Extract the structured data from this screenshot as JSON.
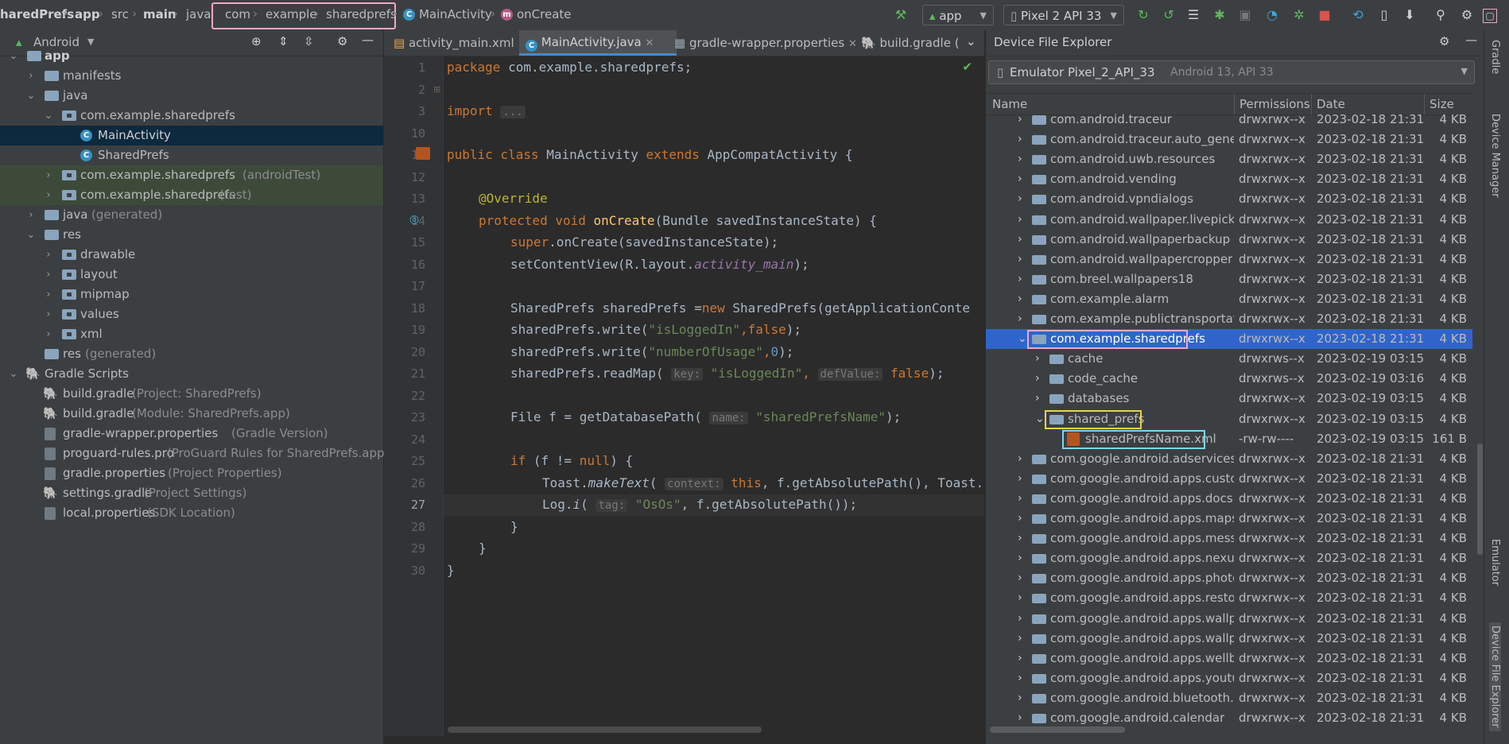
{
  "breadcrumb": [
    "haredPrefs",
    "app",
    "src",
    "main",
    "java",
    "com",
    "example",
    "sharedprefs",
    "MainActivity",
    "onCreate"
  ],
  "toolbar": {
    "run_config": "app",
    "device": "Pixel 2 API 33"
  },
  "project_panel": {
    "view": "Android",
    "tree": [
      {
        "label": "app",
        "extra": ""
      },
      {
        "label": "manifests",
        "extra": ""
      },
      {
        "label": "java",
        "extra": ""
      },
      {
        "label": "com.example.sharedprefs",
        "extra": ""
      },
      {
        "label": "MainActivity",
        "extra": ""
      },
      {
        "label": "SharedPrefs",
        "extra": ""
      },
      {
        "label": "com.example.sharedprefs",
        "extra": "(androidTest)"
      },
      {
        "label": "com.example.sharedprefs",
        "extra": "(test)"
      },
      {
        "label": "java",
        "extra": "(generated)"
      },
      {
        "label": "res",
        "extra": ""
      },
      {
        "label": "drawable",
        "extra": ""
      },
      {
        "label": "layout",
        "extra": ""
      },
      {
        "label": "mipmap",
        "extra": ""
      },
      {
        "label": "values",
        "extra": ""
      },
      {
        "label": "xml",
        "extra": ""
      },
      {
        "label": "res",
        "extra": "(generated)"
      },
      {
        "label": "Gradle Scripts",
        "extra": ""
      },
      {
        "label": "build.gradle",
        "extra": "(Project: SharedPrefs)"
      },
      {
        "label": "build.gradle",
        "extra": "(Module: SharedPrefs.app)"
      },
      {
        "label": "gradle-wrapper.properties",
        "extra": "(Gradle Version)"
      },
      {
        "label": "proguard-rules.pro",
        "extra": "(ProGuard Rules for SharedPrefs.app)"
      },
      {
        "label": "gradle.properties",
        "extra": "(Project Properties)"
      },
      {
        "label": "settings.gradle",
        "extra": "(Project Settings)"
      },
      {
        "label": "local.properties",
        "extra": "(SDK Location)"
      }
    ]
  },
  "editor": {
    "tabs": [
      "activity_main.xml",
      "MainActivity.java",
      "gradle-wrapper.properties",
      "build.gradle ("
    ],
    "line_numbers": [
      "1",
      "2",
      "3",
      "10",
      "11",
      "12",
      "13",
      "14",
      "15",
      "16",
      "17",
      "18",
      "19",
      "20",
      "21",
      "22",
      "23",
      "24",
      "25",
      "26",
      "27",
      "28",
      "29",
      "30"
    ],
    "code": {
      "l1a": "package",
      "l1b": " com.example.sharedprefs;",
      "l3a": "import",
      "l3b": "...",
      "l11a": "public class",
      "l11b": " MainActivity ",
      "l11c": "extends",
      "l11d": " AppCompatActivity {",
      "l13": "@Override",
      "l14a": "protected void",
      "l14b": "onCreate",
      "l14c": "(Bundle savedInstanceState) {",
      "l15a": "super",
      "l15b": ".onCreate(savedInstanceState);",
      "l16a": "setContentView(R.layout.",
      "l16b": "activity_main",
      "l16c": ");",
      "l18a": "SharedPrefs sharedPrefs =",
      "l18b": "new",
      "l18c": " SharedPrefs(getApplicationConte",
      "l19a": "sharedPrefs.write(",
      "l19b": "\"isLoggedIn\"",
      "l19c": ",",
      "l19d": "false",
      "l19e": ");",
      "l20a": "sharedPrefs.write(",
      "l20b": "\"numberOfUsage\"",
      "l20c": ",",
      "l20d": "0",
      "l20e": ");",
      "l21a": "sharedPrefs.readMap(",
      "l21h1": "key:",
      "l21b": "\"isLoggedIn\"",
      "l21c": ",",
      "l21h2": "defValue:",
      "l21d": "false",
      "l21e": ");",
      "l23a": "File f = getDatabasePath(",
      "l23h": "name:",
      "l23b": "\"sharedPrefsName\"",
      "l23c": ");",
      "l25a": "if",
      "l25b": " (f != ",
      "l25c": "null",
      "l25d": ") {",
      "l26a": "Toast.",
      "l26b": "makeText",
      "l26c": "(",
      "l26h": "context:",
      "l26d": "this",
      "l26e": ", f.getAbsolutePath(), Toast.",
      "l27a": "Log.",
      "l27b": "i",
      "l27c": "(",
      "l27h": "tag:",
      "l27d": "\"OsOs\"",
      "l27e": ", f.getAbsolutePath());",
      "l28": "}",
      "l29": "}",
      "l30": "}"
    }
  },
  "device_explorer": {
    "title": "Device File Explorer",
    "device": "Emulator Pixel_2_API_33",
    "device_info": "Android 13, API 33",
    "columns": [
      "Name",
      "Permissions",
      "Date",
      "Size"
    ],
    "rows": [
      {
        "name": "com.android.traceur",
        "perm": "drwxrwx--x",
        "date": "2023-02-18 21:31",
        "size": "4 KB"
      },
      {
        "name": "com.android.traceur.auto_gener",
        "perm": "drwxrwx--x",
        "date": "2023-02-18 21:31",
        "size": "4 KB"
      },
      {
        "name": "com.android.uwb.resources",
        "perm": "drwxrwx--x",
        "date": "2023-02-18 21:31",
        "size": "4 KB"
      },
      {
        "name": "com.android.vending",
        "perm": "drwxrwx--x",
        "date": "2023-02-18 21:31",
        "size": "4 KB"
      },
      {
        "name": "com.android.vpndialogs",
        "perm": "drwxrwx--x",
        "date": "2023-02-18 21:31",
        "size": "4 KB"
      },
      {
        "name": "com.android.wallpaper.livepicke",
        "perm": "drwxrwx--x",
        "date": "2023-02-18 21:31",
        "size": "4 KB"
      },
      {
        "name": "com.android.wallpaperbackup",
        "perm": "drwxrwx--x",
        "date": "2023-02-18 21:31",
        "size": "4 KB"
      },
      {
        "name": "com.android.wallpapercropper",
        "perm": "drwxrwx--x",
        "date": "2023-02-18 21:31",
        "size": "4 KB"
      },
      {
        "name": "com.breel.wallpapers18",
        "perm": "drwxrwx--x",
        "date": "2023-02-18 21:31",
        "size": "4 KB"
      },
      {
        "name": "com.example.alarm",
        "perm": "drwxrwx--x",
        "date": "2023-02-18 21:31",
        "size": "4 KB"
      },
      {
        "name": "com.example.publictransportati",
        "perm": "drwxrwx--x",
        "date": "2023-02-18 21:31",
        "size": "4 KB"
      },
      {
        "name": "com.example.sharedprefs",
        "perm": "drwxrwx--x",
        "date": "2023-02-18 21:31",
        "size": "4 KB"
      },
      {
        "name": "cache",
        "perm": "drwxrws--x",
        "date": "2023-02-19 03:15",
        "size": "4 KB"
      },
      {
        "name": "code_cache",
        "perm": "drwxrws--x",
        "date": "2023-02-19 03:16",
        "size": "4 KB"
      },
      {
        "name": "databases",
        "perm": "drwxrwx--x",
        "date": "2023-02-19 03:15",
        "size": "4 KB"
      },
      {
        "name": "shared_prefs",
        "perm": "drwxrwx--x",
        "date": "2023-02-19 03:15",
        "size": "4 KB"
      },
      {
        "name": "sharedPrefsName.xml",
        "perm": "-rw-rw----",
        "date": "2023-02-19 03:15",
        "size": "161 B"
      },
      {
        "name": "com.google.android.adservices.",
        "perm": "drwxrwx--x",
        "date": "2023-02-18 21:31",
        "size": "4 KB"
      },
      {
        "name": "com.google.android.apps.custo",
        "perm": "drwxrwx--x",
        "date": "2023-02-18 21:31",
        "size": "4 KB"
      },
      {
        "name": "com.google.android.apps.docs",
        "perm": "drwxrwx--x",
        "date": "2023-02-18 21:31",
        "size": "4 KB"
      },
      {
        "name": "com.google.android.apps.maps",
        "perm": "drwxrwx--x",
        "date": "2023-02-18 21:31",
        "size": "4 KB"
      },
      {
        "name": "com.google.android.apps.messa",
        "perm": "drwxrwx--x",
        "date": "2023-02-18 21:31",
        "size": "4 KB"
      },
      {
        "name": "com.google.android.apps.nexus",
        "perm": "drwxrwx--x",
        "date": "2023-02-18 21:31",
        "size": "4 KB"
      },
      {
        "name": "com.google.android.apps.photc",
        "perm": "drwxrwx--x",
        "date": "2023-02-18 21:31",
        "size": "4 KB"
      },
      {
        "name": "com.google.android.apps.restor",
        "perm": "drwxrwx--x",
        "date": "2023-02-18 21:31",
        "size": "4 KB"
      },
      {
        "name": "com.google.android.apps.wallp",
        "perm": "drwxrwx--x",
        "date": "2023-02-18 21:31",
        "size": "4 KB"
      },
      {
        "name": "com.google.android.apps.wallp",
        "perm": "drwxrwx--x",
        "date": "2023-02-18 21:31",
        "size": "4 KB"
      },
      {
        "name": "com.google.android.apps.wellb",
        "perm": "drwxrwx--x",
        "date": "2023-02-18 21:31",
        "size": "4 KB"
      },
      {
        "name": "com.google.android.apps.youtu",
        "perm": "drwxrwx--x",
        "date": "2023-02-18 21:31",
        "size": "4 KB"
      },
      {
        "name": "com.google.android.bluetooth.s",
        "perm": "drwxrwx--x",
        "date": "2023-02-18 21:31",
        "size": "4 KB"
      },
      {
        "name": "com.google.android.calendar",
        "perm": "drwxrwx--x",
        "date": "2023-02-18 21:31",
        "size": "4 KB"
      }
    ]
  },
  "right_toolbar": [
    "Gradle",
    "Device Manager",
    "Emulator",
    "Device File Explorer"
  ],
  "colors": {
    "selection": "#0d293e",
    "dfe_selection": "#2f65ca",
    "highlight_pink": "#f1a7c4",
    "highlight_yellow": "#e8d44d",
    "highlight_cyan": "#7ed6f0"
  }
}
